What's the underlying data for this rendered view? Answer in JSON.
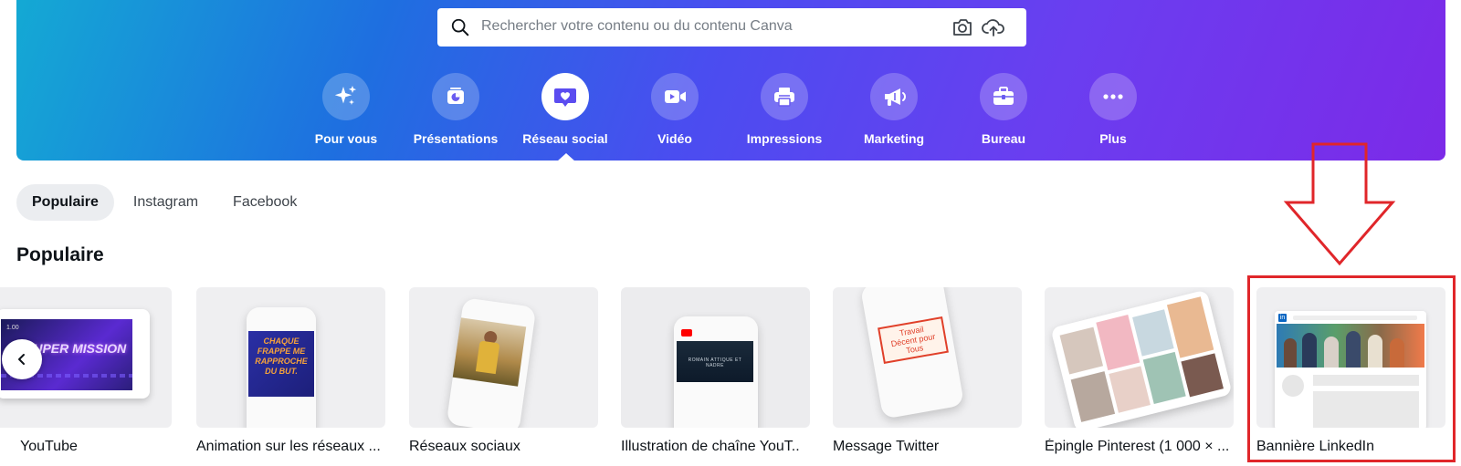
{
  "search": {
    "placeholder": "Rechercher votre contenu ou du contenu Canva",
    "icon": "search-icon",
    "tools": [
      "camera-icon",
      "upload-cloud-icon"
    ]
  },
  "categories": [
    {
      "label": "Pour vous",
      "icon": "sparkle-icon"
    },
    {
      "label": "Présentations",
      "icon": "presentation-icon"
    },
    {
      "label": "Réseau social",
      "icon": "heart-chat-icon",
      "active": true
    },
    {
      "label": "Vidéo",
      "icon": "video-camera-icon"
    },
    {
      "label": "Impressions",
      "icon": "printer-icon"
    },
    {
      "label": "Marketing",
      "icon": "megaphone-icon"
    },
    {
      "label": "Bureau",
      "icon": "briefcase-icon"
    },
    {
      "label": "Plus",
      "icon": "more-dots-icon"
    }
  ],
  "tabs": [
    {
      "label": "Populaire",
      "active": true
    },
    {
      "label": "Instagram"
    },
    {
      "label": "Facebook"
    }
  ],
  "section": {
    "title": "Populaire"
  },
  "templates": [
    {
      "label": "YouTube",
      "thumb_text": "SUPER MISSION",
      "badge": "1.00"
    },
    {
      "label": "Animation sur les réseaux ...",
      "thumb_text": "CHAQUE FRAPPE ME RAPPROCHE DU BUT."
    },
    {
      "label": "Réseaux sociaux"
    },
    {
      "label": "Illustration de chaîne YouT..",
      "thumb_text": "ROMAIN ATTIQUE ET NADRE"
    },
    {
      "label": "Message Twitter",
      "thumb_text": "Travail Décent pour Tous"
    },
    {
      "label": "Épingle Pinterest (1 000 × ..."
    },
    {
      "label": "Bannière LinkedIn",
      "badge": "in",
      "highlighted": true
    }
  ],
  "colors": {
    "accent": "#7c2ae8",
    "highlight": "#e0262a",
    "youtube_red": "#ff0000",
    "linkedin_blue": "#0a66c2"
  },
  "controls": {
    "prev_icon": "chevron-left-icon"
  }
}
